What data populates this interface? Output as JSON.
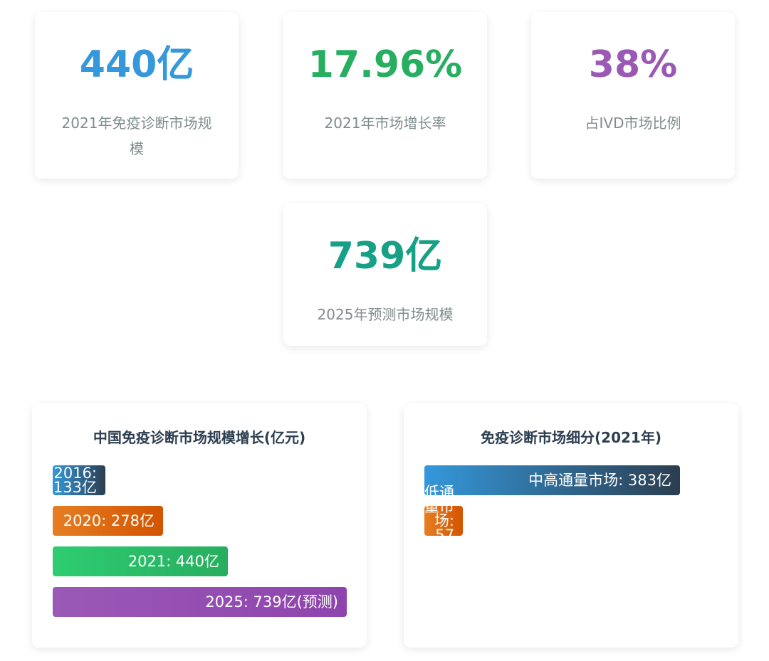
{
  "stats": [
    {
      "value": "440亿",
      "label": "2021年免疫诊断市场规模",
      "color": "#3498db"
    },
    {
      "value": "17.96%",
      "label": "2021年市场增长率",
      "color": "#27ae60"
    },
    {
      "value": "38%",
      "label": "占IVD市场比例",
      "color": "#9b59b6"
    },
    {
      "value": "739亿",
      "label": "2025年预测市场规模",
      "color": "#16a085"
    }
  ],
  "chart_data": [
    {
      "type": "bar",
      "orientation": "horizontal",
      "title": "中国免疫诊断市场规模增长(亿元)",
      "max": 739,
      "bars": [
        {
          "label": "2016: 133亿",
          "value": 133,
          "colors": [
            "#3498db",
            "#2c3e50"
          ]
        },
        {
          "label": "2020: 278亿",
          "value": 278,
          "colors": [
            "#e67e22",
            "#d35400"
          ]
        },
        {
          "label": "2021: 440亿",
          "value": 440,
          "colors": [
            "#2ecc71",
            "#27ae60"
          ]
        },
        {
          "label": "2025: 739亿(预测)",
          "value": 739,
          "colors": [
            "#9b59b6",
            "#8e44ad"
          ]
        }
      ]
    },
    {
      "type": "bar",
      "orientation": "horizontal",
      "title": "免疫诊断市场细分(2021年)",
      "max": 440,
      "bars": [
        {
          "label": "中高通量市场: 383亿",
          "value": 383,
          "colors": [
            "#3498db",
            "#2c3e50"
          ]
        },
        {
          "label": "低通量市场: 57亿",
          "value": 57,
          "colors": [
            "#e67e22",
            "#d35400"
          ]
        }
      ]
    }
  ]
}
